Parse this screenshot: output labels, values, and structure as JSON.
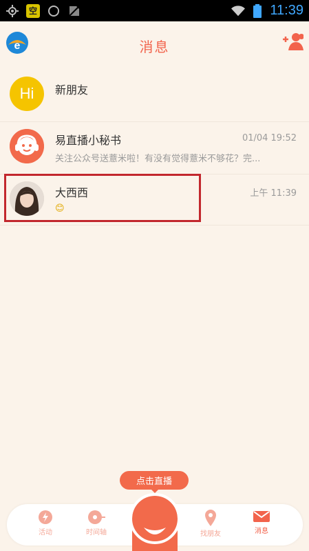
{
  "status_bar": {
    "left_icons": [
      "gps-icon",
      "kong-icon",
      "moon-icon",
      "no-sim-icon"
    ],
    "kong_text": "空",
    "right_icons": [
      "wifi-icon",
      "battery-icon"
    ],
    "time": "11:39"
  },
  "header": {
    "title": "消息",
    "left_icon": "app-logo",
    "right_icon": "add-friend-icon"
  },
  "messages": [
    {
      "name": "新朋友",
      "preview": "",
      "time": "",
      "avatar_text": "Hi",
      "avatar_color": "#f5c400"
    },
    {
      "name": "易直播小秘书",
      "preview": "关注公众号送薏米啦！有没有觉得薏米不够花？完...",
      "time": "01/04 19:52",
      "avatar_color": "#f26a4b"
    },
    {
      "name": "大西西",
      "preview": "😊",
      "time": "上午 11:39",
      "avatar_color": "#8a6f60"
    }
  ],
  "live_button": {
    "label": "点击直播"
  },
  "nav": [
    {
      "label": "活动",
      "icon": "activity-icon"
    },
    {
      "label": "时间轴",
      "icon": "timeline-icon"
    },
    {
      "label": "找朋友",
      "icon": "find-friends-icon"
    },
    {
      "label": "消息",
      "icon": "mail-icon"
    }
  ],
  "colors": {
    "accent": "#f2634c",
    "background": "#fbf3ea",
    "highlight": "#c2272d"
  }
}
